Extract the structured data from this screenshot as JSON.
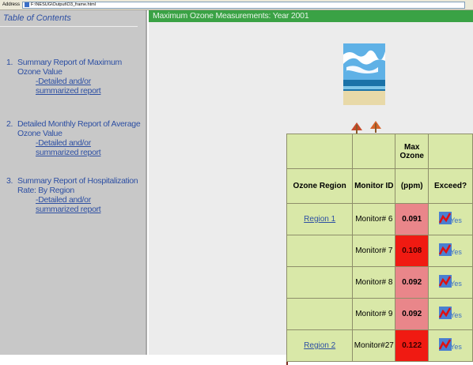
{
  "address_bar": {
    "label": "Address",
    "url": "F:\\NESUG\\Output\\O3_frame.html"
  },
  "toc": {
    "title": "Table of Contents",
    "items": [
      {
        "num": "1.",
        "title": "Summary Report of Maximum Ozone Value",
        "link": "-Detailed and/or summarized report"
      },
      {
        "num": "2.",
        "title": "Detailed Monthly Report of Average Ozone Value",
        "link": "-Detailed and/or summarized report"
      },
      {
        "num": "3.",
        "title": "Summary Report of Hospitalization Rate: By Region",
        "link": "-Detailed and/or summarized report"
      }
    ]
  },
  "main": {
    "title": "Maximum Ozone Measurements: Year 2001",
    "table": {
      "super_header": {
        "max_ozone": "Max Ozone"
      },
      "headers": {
        "region": "Ozone Region",
        "monitor": "Monitor ID",
        "ppm": "(ppm)",
        "exceed": "Exceed?"
      },
      "rows": [
        {
          "region": "Region 1",
          "monitor": "Monitor# 6",
          "value": "0.091",
          "exceed": "Yes",
          "level": "pink"
        },
        {
          "region": "",
          "monitor": "Monitor# 7",
          "value": "0.108",
          "exceed": "Yes",
          "level": "red"
        },
        {
          "region": "",
          "monitor": "Monitor# 8",
          "value": "0.092",
          "exceed": "Yes",
          "level": "pink"
        },
        {
          "region": "",
          "monitor": "Monitor# 9",
          "value": "0.092",
          "exceed": "Yes",
          "level": "pink"
        },
        {
          "region": "Region 2",
          "monitor": "Monitor#27",
          "value": "0.122",
          "exceed": "Yes",
          "level": "red"
        }
      ]
    }
  },
  "colors": {
    "title_bar": "#3aa245",
    "table_bg": "#d9e8a8",
    "pink": "#e9868a",
    "red": "#f01a12",
    "link": "#2d4fa3"
  }
}
